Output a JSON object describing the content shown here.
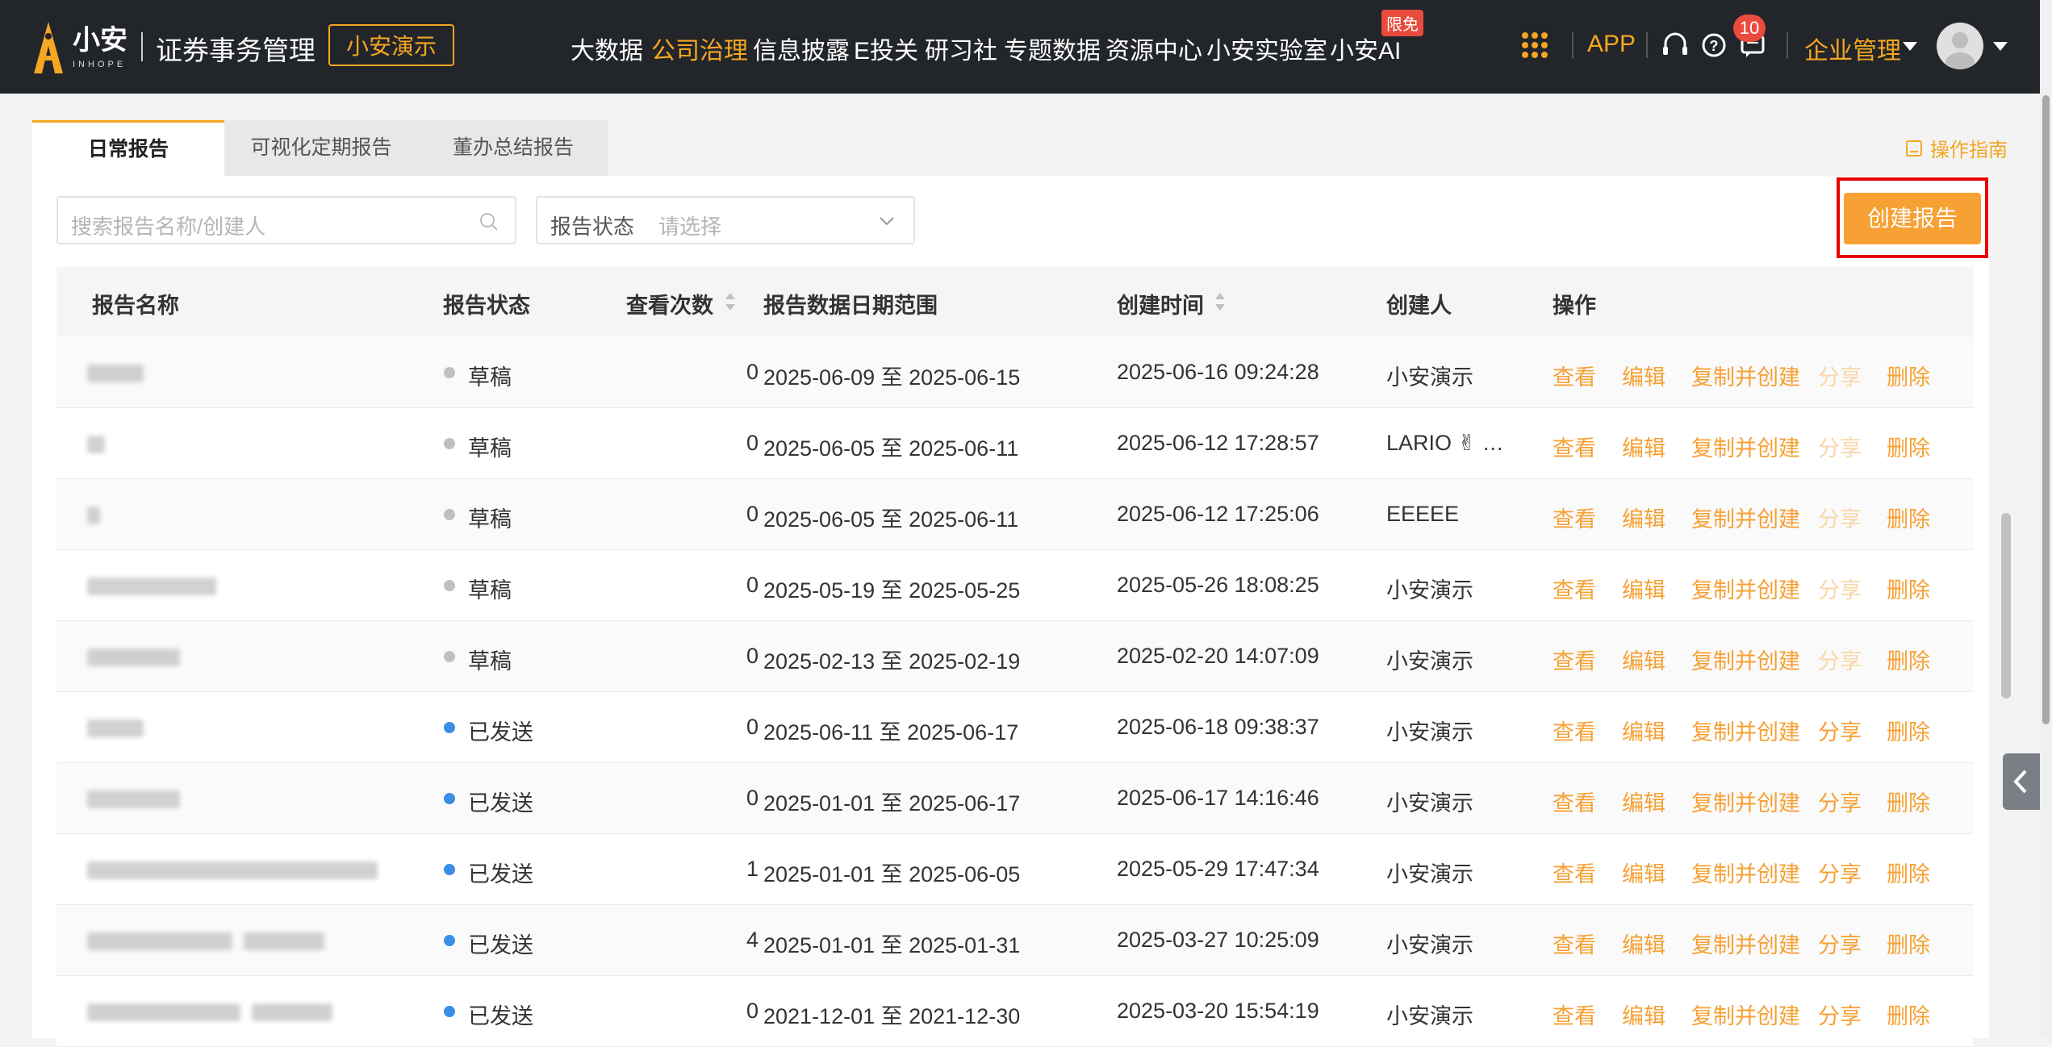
{
  "header": {
    "logo_name": "小安",
    "logo_sub": "INHOPE",
    "app_title": "证券事务管理",
    "org_button": "小安演示",
    "nav": [
      {
        "label": "大数据",
        "active": false
      },
      {
        "label": "公司治理",
        "active": true
      },
      {
        "label": "信息披露",
        "active": false
      },
      {
        "label": "E投关",
        "active": false
      },
      {
        "label": "研习社",
        "active": false
      },
      {
        "label": "专题数据",
        "active": false
      },
      {
        "label": "资源中心",
        "active": false
      },
      {
        "label": "小安实验室",
        "active": false
      },
      {
        "label": "小安AI",
        "active": false
      }
    ],
    "free_badge": "限免",
    "app_link": "APP",
    "message_count": "10",
    "enterprise_menu": "企业管理"
  },
  "tabs": [
    {
      "label": "日常报告",
      "active": true
    },
    {
      "label": "可视化定期报告",
      "active": false
    },
    {
      "label": "董办总结报告",
      "active": false
    }
  ],
  "guide_link": "操作指南",
  "filters": {
    "search_placeholder": "搜索报告名称/创建人",
    "status_label": "报告状态",
    "status_placeholder": "请选择"
  },
  "create_button": "创建报告",
  "table": {
    "columns": [
      "报告名称",
      "报告状态",
      "查看次数",
      "报告数据日期范围",
      "创建时间",
      "创建人",
      "操作"
    ],
    "actions": [
      "查看",
      "编辑",
      "复制并创建",
      "分享",
      "删除"
    ],
    "rows": [
      {
        "status": "草稿",
        "sent": false,
        "views": "0",
        "range": "2025-06-09 至 2025-06-15",
        "created": "2025-06-16 09:24:28",
        "creator": "小安演示"
      },
      {
        "status": "草稿",
        "sent": false,
        "views": "0",
        "range": "2025-06-05 至 2025-06-11",
        "created": "2025-06-12 17:28:57",
        "creator": "LARIO ✌ …"
      },
      {
        "status": "草稿",
        "sent": false,
        "views": "0",
        "range": "2025-06-05 至 2025-06-11",
        "created": "2025-06-12 17:25:06",
        "creator": "EEEEE"
      },
      {
        "status": "草稿",
        "sent": false,
        "views": "0",
        "range": "2025-05-19 至 2025-05-25",
        "created": "2025-05-26 18:08:25",
        "creator": "小安演示"
      },
      {
        "status": "草稿",
        "sent": false,
        "views": "0",
        "range": "2025-02-13 至 2025-02-19",
        "created": "2025-02-20 14:07:09",
        "creator": "小安演示"
      },
      {
        "status": "已发送",
        "sent": true,
        "views": "0",
        "range": "2025-06-11 至 2025-06-17",
        "created": "2025-06-18 09:38:37",
        "creator": "小安演示"
      },
      {
        "status": "已发送",
        "sent": true,
        "views": "0",
        "range": "2025-01-01 至 2025-06-17",
        "created": "2025-06-17 14:16:46",
        "creator": "小安演示"
      },
      {
        "status": "已发送",
        "sent": true,
        "views": "1",
        "range": "2025-01-01 至 2025-06-05",
        "created": "2025-05-29 17:47:34",
        "creator": "小安演示"
      },
      {
        "status": "已发送",
        "sent": true,
        "views": "4",
        "range": "2025-01-01 至 2025-01-31",
        "created": "2025-03-27 10:25:09",
        "creator": "小安演示"
      },
      {
        "status": "已发送",
        "sent": true,
        "views": "0",
        "range": "2021-12-01 至 2021-12-30",
        "created": "2025-03-20 15:54:19",
        "creator": "小安演示"
      }
    ]
  },
  "colors": {
    "accent": "#f7a033",
    "draft_dot": "#c0c0c0",
    "sent_dot": "#3a8ee6",
    "highlight_box": "#e60000"
  }
}
